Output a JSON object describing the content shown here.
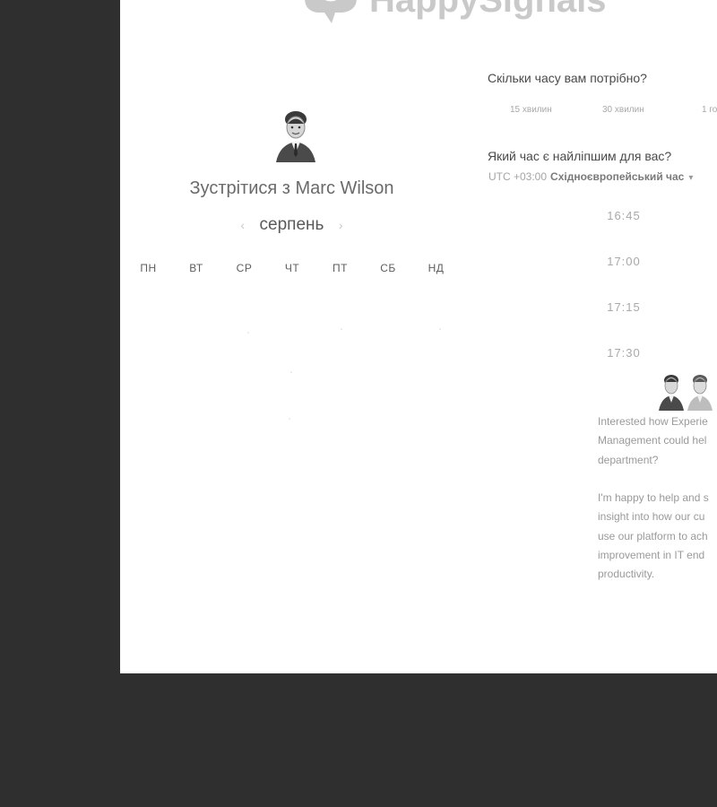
{
  "brand": {
    "name": "HappySignals"
  },
  "host": {
    "meet_prefix": "Зустрітися з ",
    "name": "Marc Wilson"
  },
  "calendar": {
    "month": "серпень",
    "prev_icon": "chevron-left-icon",
    "next_icon": "chevron-right-icon",
    "weekdays": [
      "ПН",
      "ВТ",
      "СР",
      "ЧТ",
      "ПТ",
      "СБ",
      "НД"
    ]
  },
  "duration": {
    "question": "Скільки часу вам потрібно?",
    "options": [
      "15 хвилин",
      "30 хвилин",
      "1 го"
    ]
  },
  "time": {
    "question": "Який час є найліпшим для вас?",
    "tz_offset": "UTC +03:00",
    "tz_name": "Східноєвропейський час",
    "tz_caret": "▾",
    "slots": [
      "16:45",
      "17:00",
      "17:15",
      "17:30"
    ]
  },
  "about": {
    "paragraph1": [
      "Interested how Experie",
      "Management could hel",
      "department?"
    ],
    "paragraph2": [
      "I'm happy to help and s",
      "insight into how our cu",
      "use our platform to ach",
      "improvement in IT end",
      "productivity."
    ]
  },
  "colors": {
    "backdrop": "#2f2f2f",
    "panel": "#ffffff",
    "text_dark": "#4a4a4a",
    "text_muted": "#a9a9a9"
  }
}
